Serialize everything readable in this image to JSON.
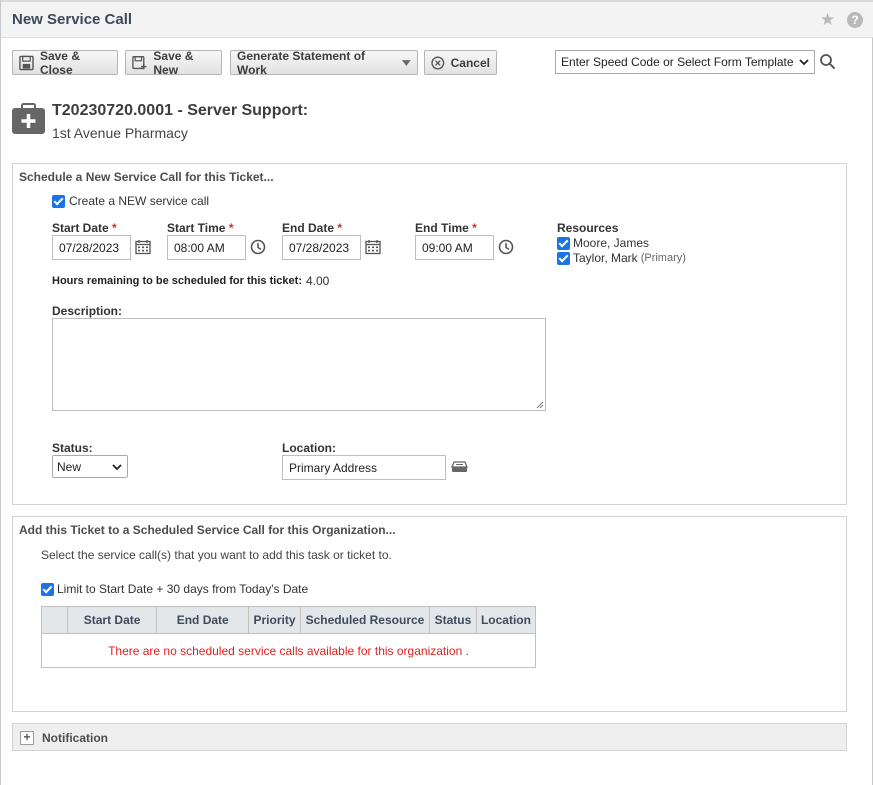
{
  "window": {
    "title": "New Service Call"
  },
  "toolbar": {
    "save_close": "Save & Close",
    "save_new": "Save & New",
    "generate_sow": "Generate Statement of Work",
    "cancel": "Cancel",
    "speed_code": "Enter Speed Code or Select Form Template"
  },
  "ticket": {
    "title": "T20230720.0001 - Server Support:",
    "organization": "1st Avenue Pharmacy"
  },
  "schedule": {
    "heading": "Schedule a New Service Call for this Ticket...",
    "create_new_label": "Create a NEW service call",
    "start_date_label": "Start Date",
    "start_date": "07/28/2023",
    "start_time_label": "Start Time",
    "start_time": "08:00 AM",
    "end_date_label": "End Date",
    "end_date": "07/28/2023",
    "end_time_label": "End Time",
    "end_time": "09:00 AM",
    "required_mark": "*",
    "resources_label": "Resources",
    "resources": [
      {
        "name": "Moore, James",
        "note": ""
      },
      {
        "name": "Taylor, Mark",
        "note": "(Primary)"
      }
    ],
    "hours_label": "Hours remaining to be scheduled for this ticket:",
    "hours_value": "4.00",
    "description_label": "Description:",
    "status_label": "Status:",
    "status_value": "New",
    "location_label": "Location:",
    "location_value": "Primary Address"
  },
  "add_existing": {
    "heading": "Add this Ticket to a Scheduled Service Call for this Organization...",
    "instructions": "Select the service call(s) that you want to add this task or ticket to.",
    "limit_label": "Limit to Start Date + 30 days from Today's Date",
    "columns": [
      "Start Date",
      "End Date",
      "Priority",
      "Scheduled Resource",
      "Status",
      "Location"
    ],
    "empty_message": "There are no scheduled service calls available for this organization ."
  },
  "notification": {
    "label": "Notification"
  },
  "colors": {
    "accent": "#1a73e8",
    "required": "#d03030",
    "error": "#e02020"
  }
}
